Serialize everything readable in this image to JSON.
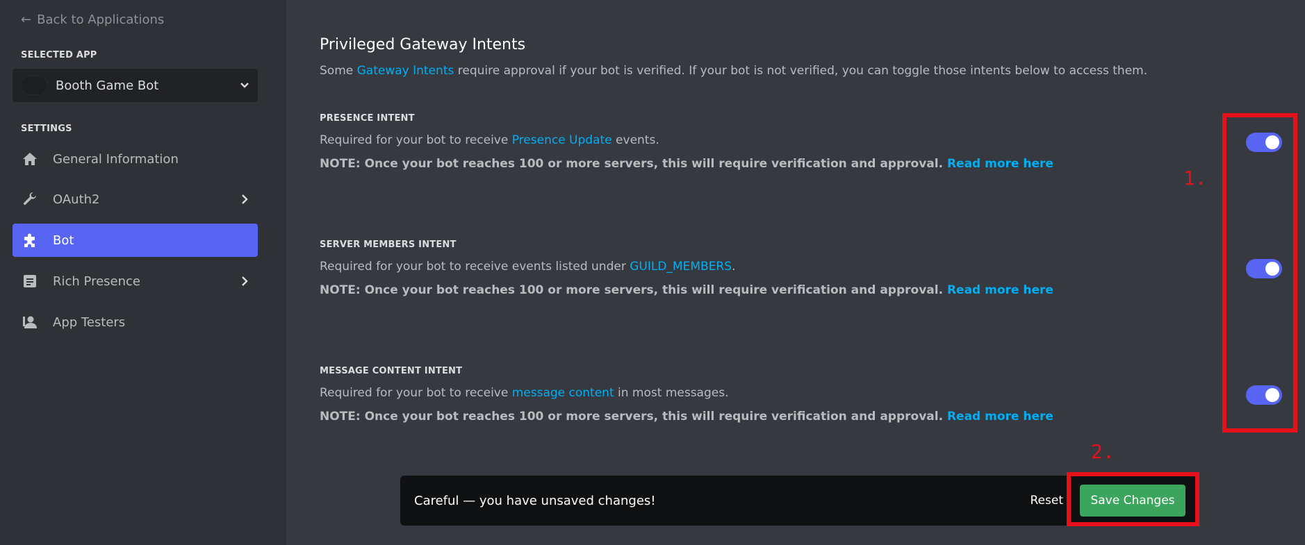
{
  "sidebar": {
    "back_label": "Back to Applications",
    "selected_app_label": "SELECTED APP",
    "app_name": "Booth Game Bot",
    "settings_label": "SETTINGS",
    "items": [
      {
        "label": "General Information",
        "icon": "home-icon"
      },
      {
        "label": "OAuth2",
        "icon": "wrench-icon"
      },
      {
        "label": "Bot",
        "icon": "puzzle-icon"
      },
      {
        "label": "Rich Presence",
        "icon": "document-icon"
      },
      {
        "label": "App Testers",
        "icon": "user-icon"
      }
    ]
  },
  "main": {
    "title": "Privileged Gateway Intents",
    "desc_before": "Some ",
    "desc_link": "Gateway Intents",
    "desc_after": " require approval if your bot is verified. If your bot is not verified, you can toggle those intents below to access them.",
    "intents": [
      {
        "title": "PRESENCE INTENT",
        "desc_before": "Required for your bot to receive ",
        "desc_link": "Presence Update",
        "desc_after": " events.",
        "note": "NOTE: Once your bot reaches 100 or more servers, this will require verification and approval. ",
        "note_link": "Read more here",
        "enabled": true
      },
      {
        "title": "SERVER MEMBERS INTENT",
        "desc_before": "Required for your bot to receive events listed under ",
        "desc_link": "GUILD_MEMBERS",
        "desc_after": ".",
        "note": "NOTE: Once your bot reaches 100 or more servers, this will require verification and approval. ",
        "note_link": "Read more here",
        "enabled": true
      },
      {
        "title": "MESSAGE CONTENT INTENT",
        "desc_before": "Required for your bot to receive ",
        "desc_link": "message content",
        "desc_after": " in most messages.",
        "note": "NOTE: Once your bot reaches 100 or more servers, this will require verification and approval. ",
        "note_link": "Read more here",
        "enabled": true
      }
    ]
  },
  "notice": {
    "text": "Careful — you have unsaved changes!",
    "reset_label": "Reset",
    "save_label": "Save Changes"
  },
  "annotations": {
    "step1": "1.",
    "step2": "2."
  },
  "colors": {
    "accent": "#5865f2",
    "link": "#00aff4",
    "save": "#3ba55d",
    "annotation": "#e8101a"
  }
}
